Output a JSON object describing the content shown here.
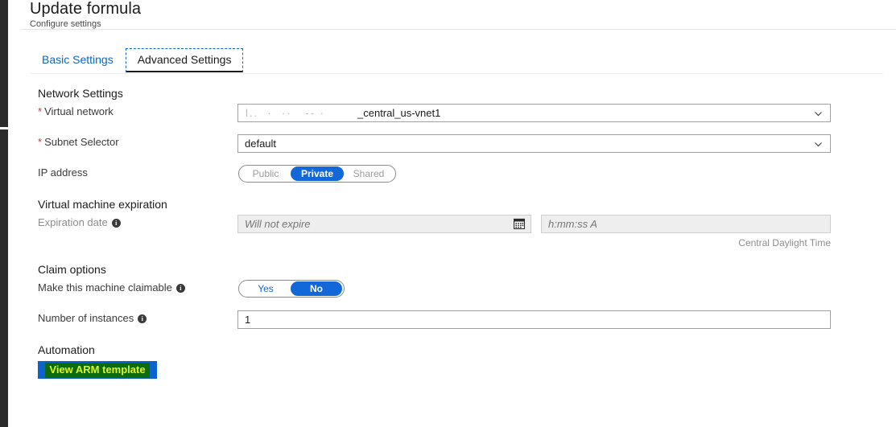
{
  "header": {
    "title": "Update formula",
    "subtitle": "Configure settings"
  },
  "tabs": [
    {
      "label": "Basic Settings",
      "active": false
    },
    {
      "label": "Advanced Settings",
      "active": true
    }
  ],
  "sections": {
    "network": {
      "title": "Network Settings",
      "virtual_network": {
        "label": "Virtual network",
        "required_marker": "*",
        "value": "_central_us-vnet1",
        "redacted": true
      },
      "subnet_selector": {
        "label": "Subnet Selector",
        "required_marker": "*",
        "value": "default"
      },
      "ip_address": {
        "label": "IP address",
        "options": [
          "Public",
          "Private",
          "Shared"
        ],
        "selected": "Private"
      }
    },
    "expiration": {
      "title": "Virtual machine expiration",
      "date": {
        "label": "Expiration date",
        "placeholder": "Will not expire",
        "value": "",
        "info": "i",
        "icon": "calendar-icon"
      },
      "time": {
        "placeholder": "h:mm:ss A",
        "value": ""
      },
      "timezone": "Central Daylight Time"
    },
    "claim": {
      "title": "Claim options",
      "claimable": {
        "label": "Make this machine claimable",
        "info": "i",
        "options": [
          "Yes",
          "No"
        ],
        "selected": "No"
      },
      "instances": {
        "label": "Number of instances",
        "info": "i",
        "value": "1"
      }
    },
    "automation": {
      "title": "Automation",
      "view_arm_template": "View ARM template"
    }
  },
  "colors": {
    "accent_blue": "#1268d8",
    "link_blue": "#0a66c2",
    "required_red": "#d13438",
    "button_blue": "#0b63ce",
    "highlight_green": "#0c6b0c",
    "highlight_text": "#d9f523"
  }
}
